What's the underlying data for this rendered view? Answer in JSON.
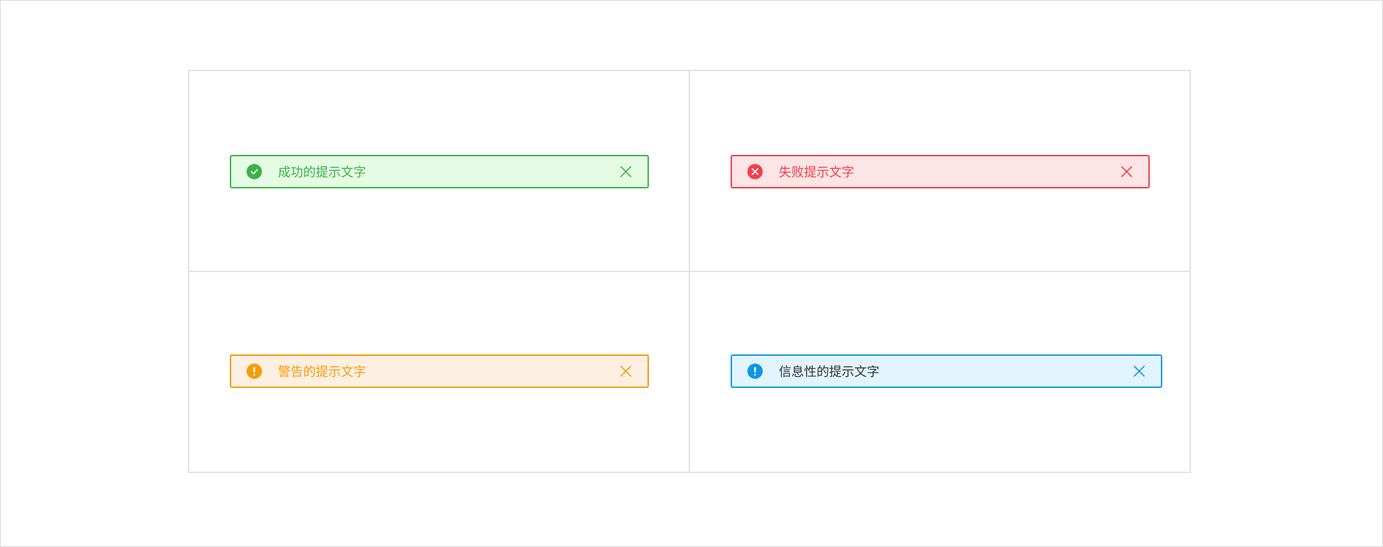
{
  "alerts": {
    "success": {
      "message": "成功的提示文字",
      "icon": "check-circle-icon",
      "close_icon": "close-icon",
      "color": "#3cb24a",
      "background": "#e5fbe3"
    },
    "error": {
      "message": "失败提示文字",
      "icon": "x-circle-icon",
      "close_icon": "close-icon",
      "color": "#f0414b",
      "background": "#fde4e5"
    },
    "warning": {
      "message": "警告的提示文字",
      "icon": "exclamation-circle-icon",
      "close_icon": "close-icon",
      "color": "#f59c0c",
      "background": "#fdf0e2"
    },
    "info": {
      "message": "信息性的提示文字",
      "icon": "info-circle-icon",
      "close_icon": "close-icon",
      "color": "#1196e6",
      "background": "#e2f4fd"
    }
  }
}
